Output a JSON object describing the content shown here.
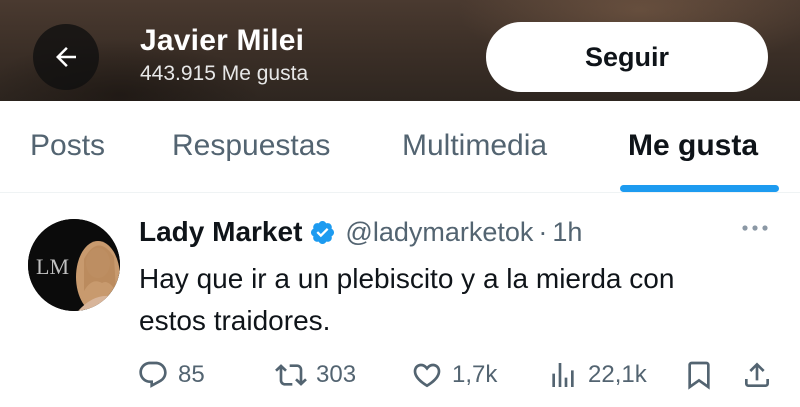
{
  "header": {
    "back_icon": "arrow-left-icon",
    "title": "Javier Milei",
    "subtitle": "443.915 Me gusta",
    "follow_label": "Seguir"
  },
  "tabs": [
    {
      "label": "Posts",
      "active": false
    },
    {
      "label": "Respuestas",
      "active": false
    },
    {
      "label": "Multimedia",
      "active": false
    },
    {
      "label": "Me gusta",
      "active": true
    }
  ],
  "colors": {
    "accent": "#1d9bf0",
    "text_primary": "#0f1419",
    "text_secondary": "#536471"
  },
  "post": {
    "avatar_monogram": "LM",
    "display_name": "Lady Market",
    "verified": true,
    "handle": "@ladymarketok",
    "separator": "·",
    "time": "1h",
    "text": "Hay que ir a un plebiscito y a la mierda con\nestos traidores.",
    "actions": {
      "replies": "85",
      "reposts": "303",
      "likes": "1,7k",
      "views": "22,1k"
    }
  }
}
